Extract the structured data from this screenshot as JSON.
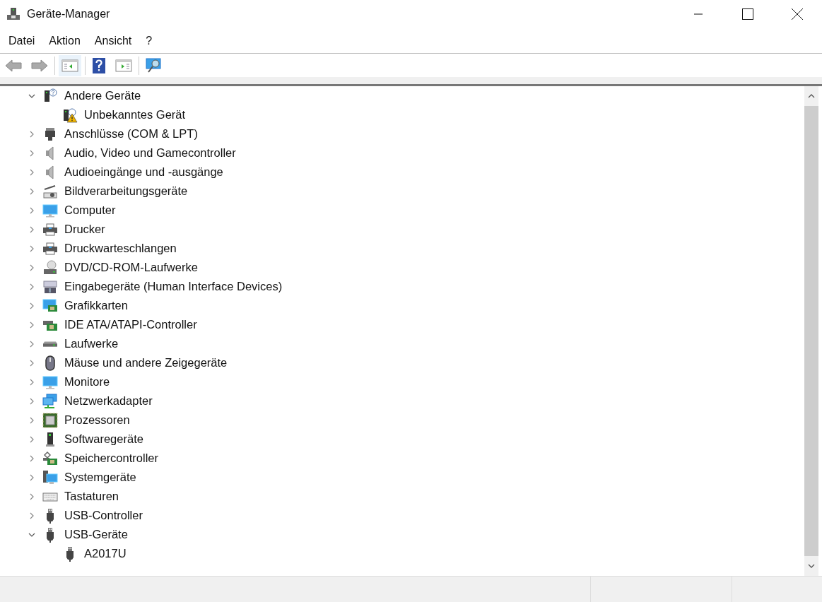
{
  "window": {
    "title": "Geräte-Manager"
  },
  "menu": [
    "Datei",
    "Aktion",
    "Ansicht",
    "?"
  ],
  "tree": [
    {
      "label": "Andere Geräte",
      "kind": "unknown",
      "expanded": true,
      "children": [
        {
          "label": "Unbekanntes Gerät",
          "kind": "warning"
        }
      ]
    },
    {
      "label": "Anschlüsse (COM & LPT)",
      "kind": "port",
      "expanded": false
    },
    {
      "label": "Audio, Video und Gamecontroller",
      "kind": "speaker",
      "expanded": false
    },
    {
      "label": "Audioeingänge und -ausgänge",
      "kind": "speaker",
      "expanded": false
    },
    {
      "label": "Bildverarbeitungsgeräte",
      "kind": "camera",
      "expanded": false
    },
    {
      "label": "Computer",
      "kind": "monitor",
      "expanded": false
    },
    {
      "label": "Drucker",
      "kind": "printer",
      "expanded": false
    },
    {
      "label": "Druckwarteschlangen",
      "kind": "printer",
      "expanded": false
    },
    {
      "label": "DVD/CD-ROM-Laufwerke",
      "kind": "disc",
      "expanded": false
    },
    {
      "label": "Eingabegeräte (Human Interface Devices)",
      "kind": "input",
      "expanded": false
    },
    {
      "label": "Grafikkarten",
      "kind": "graphics",
      "expanded": false
    },
    {
      "label": "IDE ATA/ATAPI-Controller",
      "kind": "card",
      "expanded": false
    },
    {
      "label": "Laufwerke",
      "kind": "drive",
      "expanded": false
    },
    {
      "label": "Mäuse und andere Zeigegeräte",
      "kind": "mouse",
      "expanded": false
    },
    {
      "label": "Monitore",
      "kind": "monitor",
      "expanded": false
    },
    {
      "label": "Netzwerkadapter",
      "kind": "network",
      "expanded": false
    },
    {
      "label": "Prozessoren",
      "kind": "chip",
      "expanded": false
    },
    {
      "label": "Softwaregeräte",
      "kind": "tower",
      "expanded": false
    },
    {
      "label": "Speichercontroller",
      "kind": "storage",
      "expanded": false
    },
    {
      "label": "Systemgeräte",
      "kind": "system",
      "expanded": false
    },
    {
      "label": "Tastaturen",
      "kind": "keyboard",
      "expanded": false
    },
    {
      "label": "USB-Controller",
      "kind": "usb",
      "expanded": false
    },
    {
      "label": "USB-Geräte",
      "kind": "usb",
      "expanded": true,
      "children": [
        {
          "label": "A2017U",
          "kind": "usb"
        }
      ]
    }
  ]
}
